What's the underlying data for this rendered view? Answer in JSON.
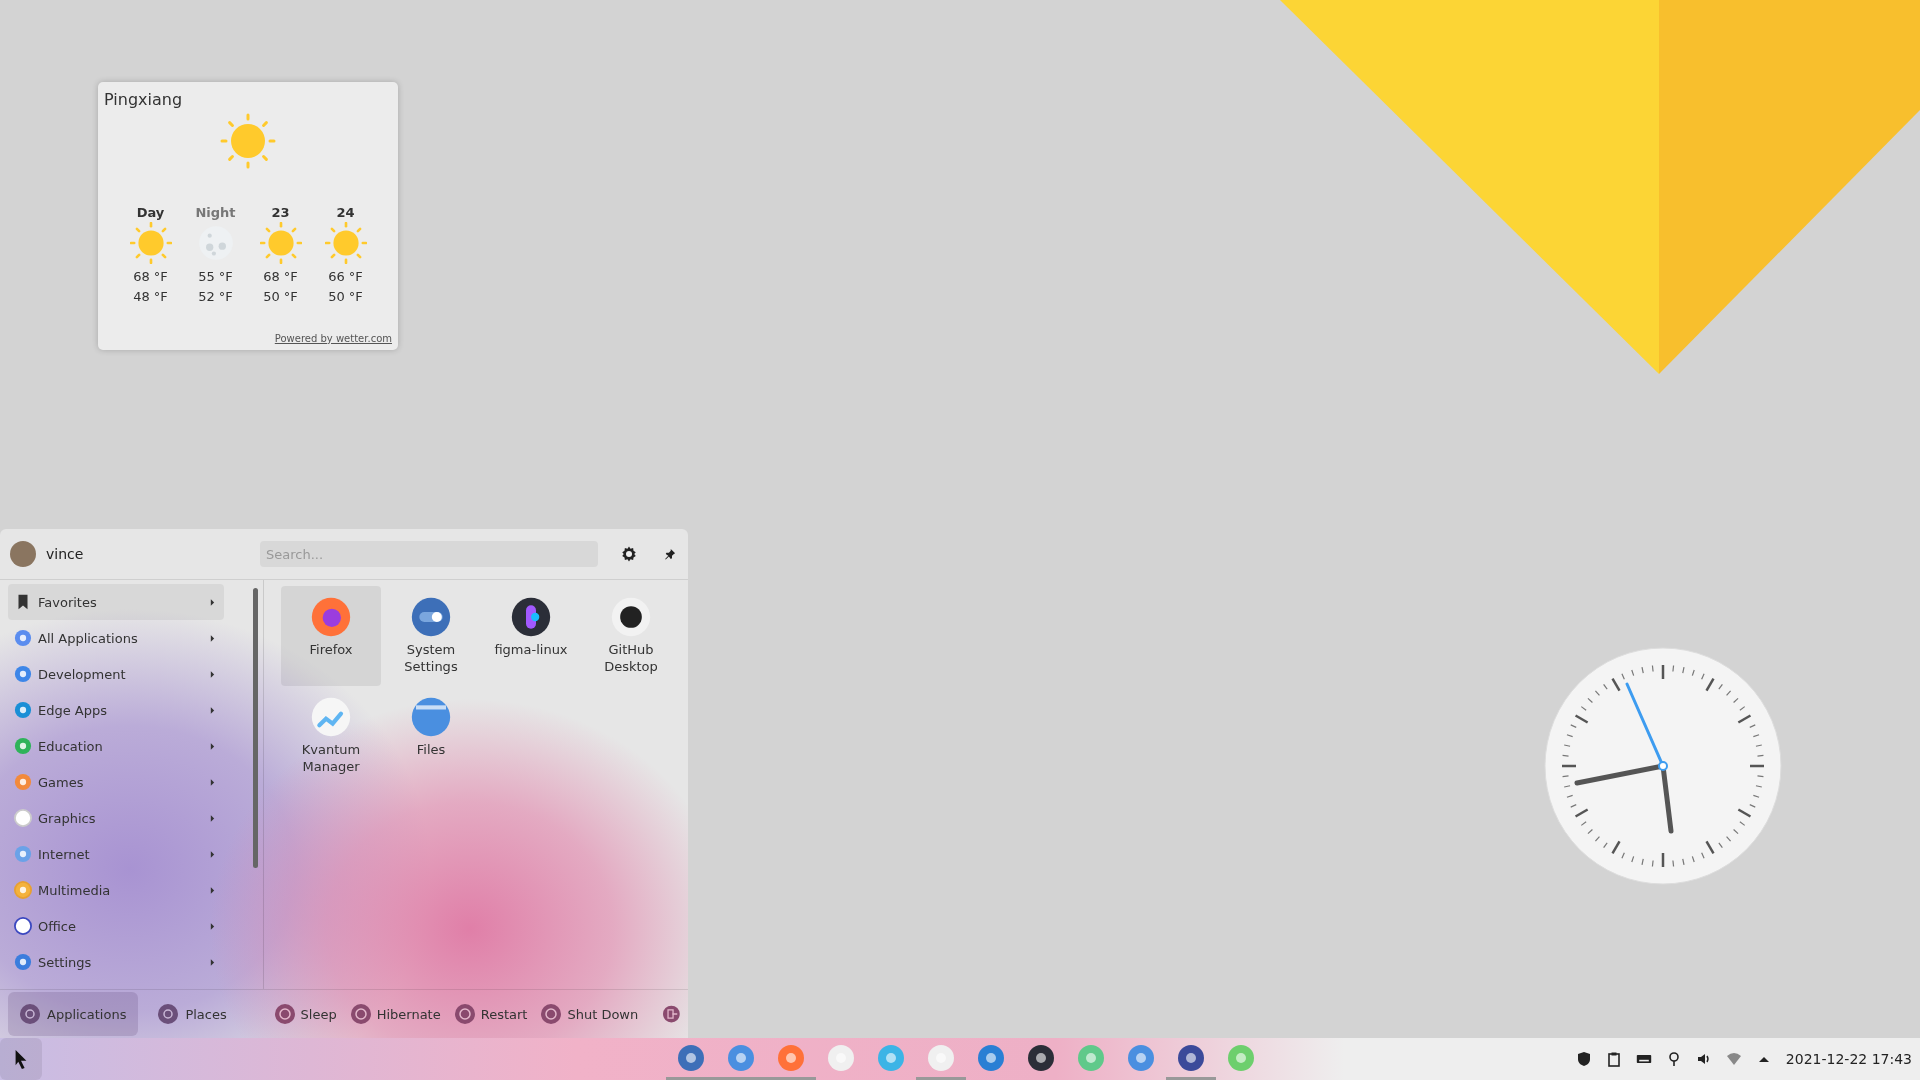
{
  "weather_widget": {
    "city": "Pingxiang",
    "periods": [
      {
        "label": "Day",
        "kind": "day",
        "high": "68 °F",
        "low": "48 °F"
      },
      {
        "label": "Night",
        "kind": "night",
        "high": "55 °F",
        "low": "52 °F"
      },
      {
        "label": "23",
        "kind": "day",
        "high": "68 °F",
        "low": "50 °F"
      },
      {
        "label": "24",
        "kind": "day",
        "high": "66 °F",
        "low": "50 °F"
      }
    ],
    "credit": "Powered by wetter.com"
  },
  "launcher": {
    "user": "vince",
    "search": {
      "placeholder": "Search..."
    },
    "categories": [
      {
        "label": "Favorites",
        "selected": true
      },
      {
        "label": "All Applications",
        "selected": false
      },
      {
        "label": "Development",
        "selected": false
      },
      {
        "label": "Edge Apps",
        "selected": false
      },
      {
        "label": "Education",
        "selected": false
      },
      {
        "label": "Games",
        "selected": false
      },
      {
        "label": "Graphics",
        "selected": false
      },
      {
        "label": "Internet",
        "selected": false
      },
      {
        "label": "Multimedia",
        "selected": false
      },
      {
        "label": "Office",
        "selected": false
      },
      {
        "label": "Settings",
        "selected": false
      }
    ],
    "apps": [
      {
        "label": "Firefox",
        "selected": true
      },
      {
        "label": "System Settings",
        "selected": false
      },
      {
        "label": "figma-linux",
        "selected": false
      },
      {
        "label": "GitHub Desktop",
        "selected": false
      },
      {
        "label": "Kvantum Manager",
        "selected": false
      },
      {
        "label": "Files",
        "selected": false
      }
    ],
    "tabs": [
      {
        "label": "Applications",
        "selected": true
      },
      {
        "label": "Places",
        "selected": false
      }
    ],
    "power": [
      {
        "label": "Sleep"
      },
      {
        "label": "Hibernate"
      },
      {
        "label": "Restart"
      },
      {
        "label": "Shut Down"
      }
    ]
  },
  "taskbar": {
    "apps": [
      {
        "running": true
      },
      {
        "running": true
      },
      {
        "running": true
      },
      {
        "running": false
      },
      {
        "running": false
      },
      {
        "running": true
      },
      {
        "running": false
      },
      {
        "running": false
      },
      {
        "running": false
      },
      {
        "running": false
      },
      {
        "running": true
      },
      {
        "running": false
      }
    ],
    "clock": "2021-12-22 17:43"
  }
}
